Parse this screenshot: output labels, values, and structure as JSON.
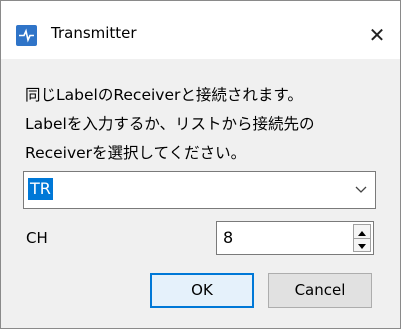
{
  "window": {
    "title": "Transmitter",
    "close_label": "✕",
    "icon": "transmitter-app-icon"
  },
  "message": "同じLabelのReceiverと接続されます。\nLabelを入力するか、リストから接続先の\nReceiverを選択してください。",
  "receiver_combo": {
    "value": "TR",
    "arrow_icon": "chevron-down-icon"
  },
  "channel": {
    "label": "CH",
    "value": "8"
  },
  "buttons": {
    "ok": "OK",
    "cancel": "Cancel"
  },
  "colors": {
    "accent": "#0078d7",
    "icon_bg": "#2f74c8"
  }
}
